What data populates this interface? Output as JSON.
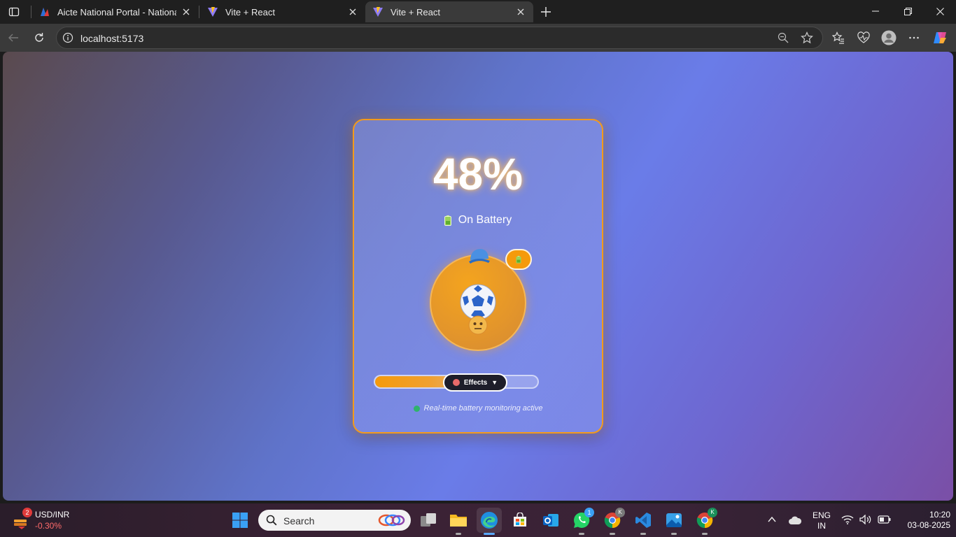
{
  "browser": {
    "tabs": [
      {
        "title": "Aicte National Portal - National In",
        "active": false,
        "favicon": "aicte-logo-icon"
      },
      {
        "title": "Vite + React",
        "active": false,
        "favicon": "vite-logo-icon"
      },
      {
        "title": "Vite + React",
        "active": true,
        "favicon": "vite-logo-icon"
      }
    ],
    "address": "localhost:5173"
  },
  "app": {
    "percent_text": "48%",
    "battery_level": 0.48,
    "status_text": "On Battery",
    "monitor_text": "Real-time battery monitoring active",
    "effects_label": "Effects",
    "effects_caret": "▼",
    "accent_color": "#f59a0c"
  },
  "taskbar": {
    "stock_name": "USD/INR",
    "stock_change": "-0.30%",
    "stock_badge": "2",
    "search_label": "Search",
    "whatsapp_badge": "1",
    "profile_initial": "K",
    "lang_top": "ENG",
    "lang_bottom": "IN",
    "time": "10:20",
    "date": "03-08-2025"
  }
}
